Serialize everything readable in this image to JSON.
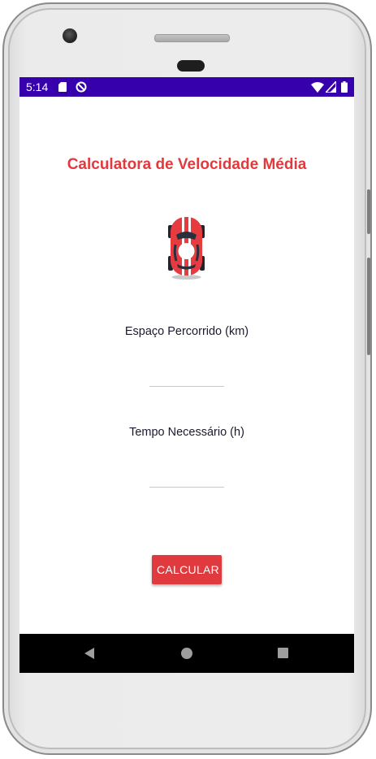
{
  "status_bar": {
    "time": "5:14",
    "background_color": "#3600ad",
    "icons": [
      "sd-card-icon",
      "do-not-disturb-icon",
      "wifi-icon",
      "signal-icon",
      "battery-icon"
    ]
  },
  "app": {
    "title": "Calculatora de Velocidade Média",
    "accent_color": "#e03a3e",
    "image": "race-car-icon",
    "distance_label": "Espaço Percorrido (km)",
    "distance_value": "",
    "time_label": "Tempo Necessário (h)",
    "time_value": "",
    "calculate_label": "CALCULAR"
  },
  "nav_bar": {
    "icons": [
      "back-icon",
      "home-icon",
      "recents-icon"
    ]
  }
}
